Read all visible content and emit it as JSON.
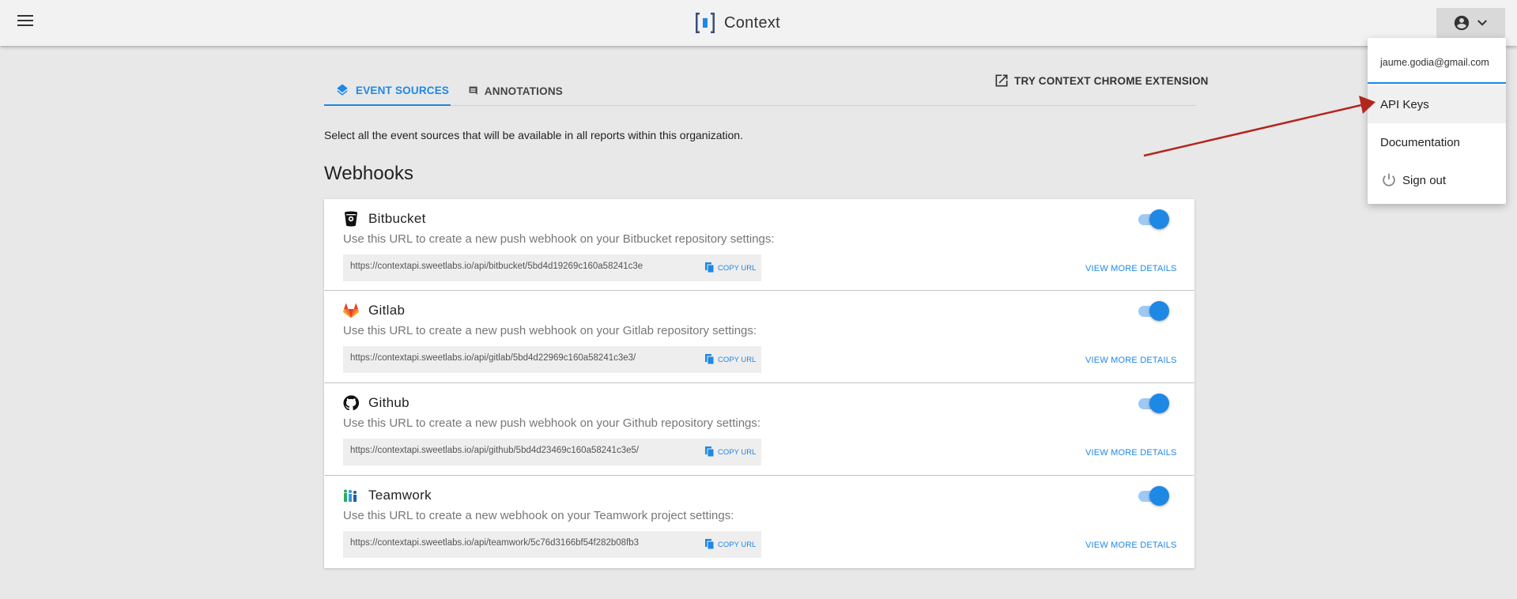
{
  "header": {
    "app_name": "Context"
  },
  "tabs": [
    {
      "label": "EVENT SOURCES"
    },
    {
      "label": "ANNOTATIONS"
    }
  ],
  "extension_link": "TRY CONTEXT CHROME EXTENSION",
  "intro": "Select all the event sources that will be available in all reports within this organization.",
  "section_title": "Webhooks",
  "cards": [
    {
      "name": "Bitbucket",
      "description": "Use this URL to create a new push webhook on your Bitbucket repository settings:",
      "url": "https://contextapi.sweetlabs.io/api/bitbucket/5bd4d19269c160a58241c3e",
      "copy_label": "COPY URL",
      "more_label": "VIEW MORE DETAILS",
      "enabled": true
    },
    {
      "name": "Gitlab",
      "description": "Use this URL to create a new push webhook on your Gitlab repository settings:",
      "url": "https://contextapi.sweetlabs.io/api/gitlab/5bd4d22969c160a58241c3e3/",
      "copy_label": "COPY URL",
      "more_label": "VIEW MORE DETAILS",
      "enabled": true
    },
    {
      "name": "Github",
      "description": "Use this URL to create a new push webhook on your Github repository settings:",
      "url": "https://contextapi.sweetlabs.io/api/github/5bd4d23469c160a58241c3e5/",
      "copy_label": "COPY URL",
      "more_label": "VIEW MORE DETAILS",
      "enabled": true
    },
    {
      "name": "Teamwork",
      "description": "Use this URL to create a new webhook on your Teamwork project settings:",
      "url": "https://contextapi.sweetlabs.io/api/teamwork/5c76d3166bf54f282b08fb3",
      "copy_label": "COPY URL",
      "more_label": "VIEW MORE DETAILS",
      "enabled": true
    }
  ],
  "account_menu": {
    "email": "jaume.godia@gmail.com",
    "items": [
      {
        "label": "API Keys"
      },
      {
        "label": "Documentation"
      },
      {
        "label": "Sign out"
      }
    ]
  },
  "colors": {
    "accent": "#1e88e5",
    "annotation_arrow": "#b3261e"
  }
}
